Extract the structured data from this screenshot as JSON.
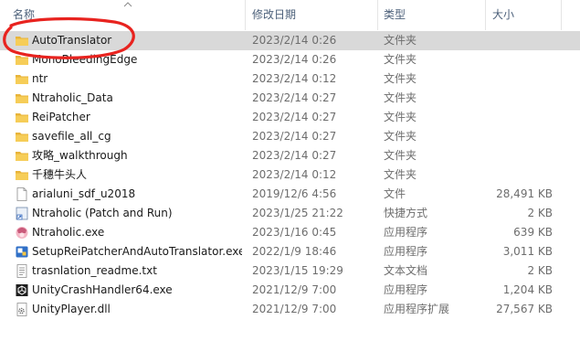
{
  "columns": {
    "name": "名称",
    "date": "修改日期",
    "type": "类型",
    "size": "大小"
  },
  "files": [
    {
      "name": "AutoTranslator",
      "date": "2023/2/14 0:26",
      "type": "文件夹",
      "size": "",
      "icon": "folder-icon",
      "selected": true
    },
    {
      "name": "MonoBleedingEdge",
      "date": "2023/2/14 0:26",
      "type": "文件夹",
      "size": "",
      "icon": "folder-icon"
    },
    {
      "name": "ntr",
      "date": "2023/2/14 0:12",
      "type": "文件夹",
      "size": "",
      "icon": "folder-icon"
    },
    {
      "name": "Ntraholic_Data",
      "date": "2023/2/14 0:27",
      "type": "文件夹",
      "size": "",
      "icon": "folder-icon"
    },
    {
      "name": "ReiPatcher",
      "date": "2023/2/14 0:27",
      "type": "文件夹",
      "size": "",
      "icon": "folder-icon"
    },
    {
      "name": "savefile_all_cg",
      "date": "2023/2/14 0:27",
      "type": "文件夹",
      "size": "",
      "icon": "folder-icon"
    },
    {
      "name": "攻略_walkthrough",
      "date": "2023/2/14 0:27",
      "type": "文件夹",
      "size": "",
      "icon": "folder-icon"
    },
    {
      "name": "千穗牛头人",
      "date": "2023/2/14 0:12",
      "type": "文件夹",
      "size": "",
      "icon": "folder-icon"
    },
    {
      "name": "arialuni_sdf_u2018",
      "date": "2019/12/6 4:56",
      "type": "文件",
      "size": "28,491 KB",
      "icon": "file-icon"
    },
    {
      "name": "Ntraholic (Patch and Run)",
      "date": "2023/1/25 21:22",
      "type": "快捷方式",
      "size": "2 KB",
      "icon": "shortcut-icon"
    },
    {
      "name": "Ntraholic.exe",
      "date": "2023/1/16 0:45",
      "type": "应用程序",
      "size": "639 KB",
      "icon": "game-app-icon"
    },
    {
      "name": "SetupReiPatcherAndAutoTranslator.exe",
      "date": "2022/1/9 18:46",
      "type": "应用程序",
      "size": "3,011 KB",
      "icon": "setup-app-icon"
    },
    {
      "name": "trasnlation_readme.txt",
      "date": "2023/1/15 19:29",
      "type": "文本文档",
      "size": "2 KB",
      "icon": "text-file-icon"
    },
    {
      "name": "UnityCrashHandler64.exe",
      "date": "2021/12/9 7:00",
      "type": "应用程序",
      "size": "1,204 KB",
      "icon": "unity-app-icon"
    },
    {
      "name": "UnityPlayer.dll",
      "date": "2021/12/9 7:00",
      "type": "应用程序扩展",
      "size": "27,567 KB",
      "icon": "dll-file-icon"
    }
  ],
  "colors": {
    "folder": "#f3c44a",
    "selection": "#d9d9d9",
    "annotation": "#e8231f"
  }
}
